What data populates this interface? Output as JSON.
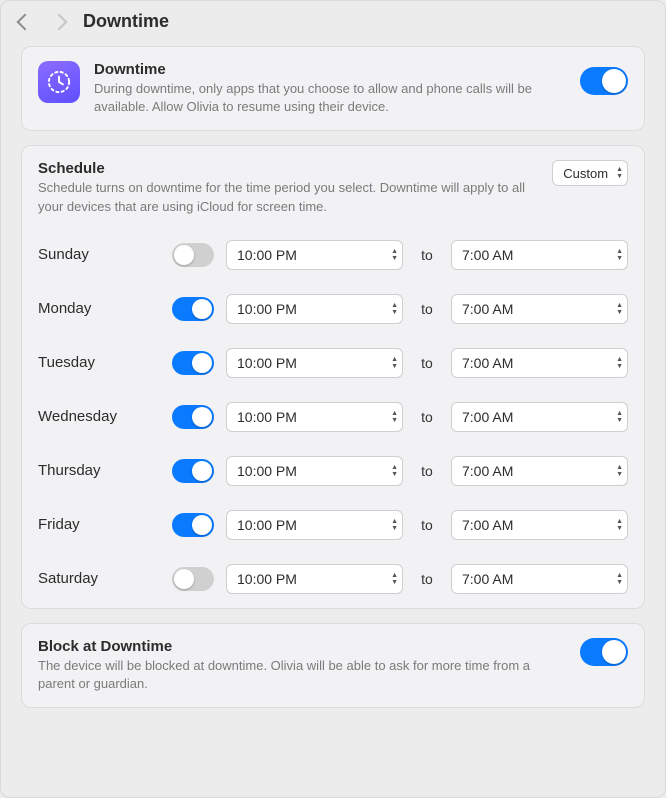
{
  "header": {
    "title": "Downtime"
  },
  "downtime": {
    "title": "Downtime",
    "description": "During downtime, only apps that you choose to allow and phone calls will be available. Allow Olivia to resume using their device.",
    "enabled": true
  },
  "schedule": {
    "title": "Schedule",
    "description": "Schedule turns on downtime for the time period you select. Downtime will apply to all your devices that are using iCloud for screen time.",
    "mode_label": "Custom",
    "to_label": "to",
    "days": [
      {
        "name": "Sunday",
        "enabled": false,
        "start": "10:00 PM",
        "end": "7:00 AM"
      },
      {
        "name": "Monday",
        "enabled": true,
        "start": "10:00 PM",
        "end": "7:00 AM"
      },
      {
        "name": "Tuesday",
        "enabled": true,
        "start": "10:00 PM",
        "end": "7:00 AM"
      },
      {
        "name": "Wednesday",
        "enabled": true,
        "start": "10:00 PM",
        "end": "7:00 AM"
      },
      {
        "name": "Thursday",
        "enabled": true,
        "start": "10:00 PM",
        "end": "7:00 AM"
      },
      {
        "name": "Friday",
        "enabled": true,
        "start": "10:00 PM",
        "end": "7:00 AM"
      },
      {
        "name": "Saturday",
        "enabled": false,
        "start": "10:00 PM",
        "end": "7:00 AM"
      }
    ]
  },
  "block": {
    "title": "Block at Downtime",
    "description": "The device will be blocked at downtime. Olivia will be able to ask for more time from a parent or guardian.",
    "enabled": true
  }
}
